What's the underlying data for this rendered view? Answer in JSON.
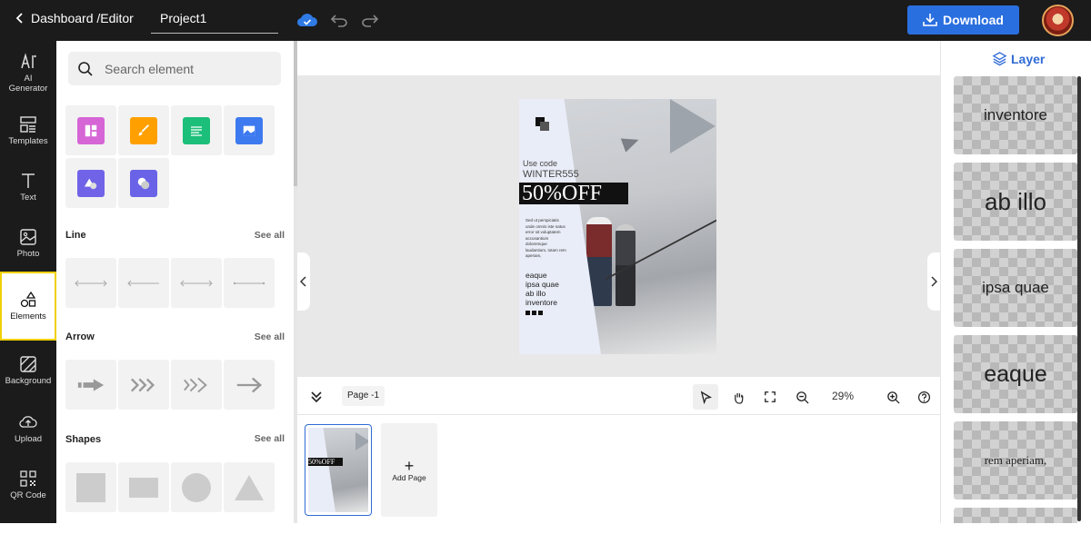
{
  "topbar": {
    "back_label": "Dashboard /Editor",
    "project_name": "Project1",
    "download_label": "Download"
  },
  "rail": {
    "items": [
      {
        "label": "AI Generator",
        "icon": "ai-icon"
      },
      {
        "label": "Templates",
        "icon": "templates-icon"
      },
      {
        "label": "Text",
        "icon": "text-icon"
      },
      {
        "label": "Photo",
        "icon": "photo-icon"
      },
      {
        "label": "Elements",
        "icon": "elements-icon"
      },
      {
        "label": "Background",
        "icon": "background-icon"
      },
      {
        "label": "Upload",
        "icon": "upload-icon"
      },
      {
        "label": "QR Code",
        "icon": "qr-code-icon"
      }
    ],
    "active": "Elements"
  },
  "panel": {
    "search_placeholder": "Search element",
    "tile_colors": [
      "#d665d6",
      "#ffa000",
      "#1bbf7a",
      "#3d7af0",
      "#7063e8",
      "#6a63e8"
    ],
    "sections": [
      {
        "title": "Line",
        "see_all": "See all"
      },
      {
        "title": "Arrow",
        "see_all": "See all"
      },
      {
        "title": "Shapes",
        "see_all": "See all"
      }
    ]
  },
  "design": {
    "use_code": "Use code",
    "code": "WINTER555",
    "offer": "50%OFF",
    "body_text": "Sed ut perspiciatis unde omnis iste natus error sit voluptatem accusantium doloremque laudantium, totam rem aperiam,",
    "list": [
      "eaque",
      "ipsa quae",
      "ab illo",
      "inventore"
    ],
    "thumb_offer": "50%OFF"
  },
  "toolbar": {
    "page_label": "Page -1",
    "zoom": "29%"
  },
  "pages": {
    "add_page_label": "Add Page"
  },
  "layers": {
    "title": "Layer",
    "items": [
      "inventore",
      "ab illo",
      "ipsa quae",
      "eaque",
      "rem aperiam,"
    ]
  },
  "colors": {
    "accent": "#2a6fe0",
    "dark_bar": "#1b1b1b",
    "active_outline": "#f0d000"
  }
}
